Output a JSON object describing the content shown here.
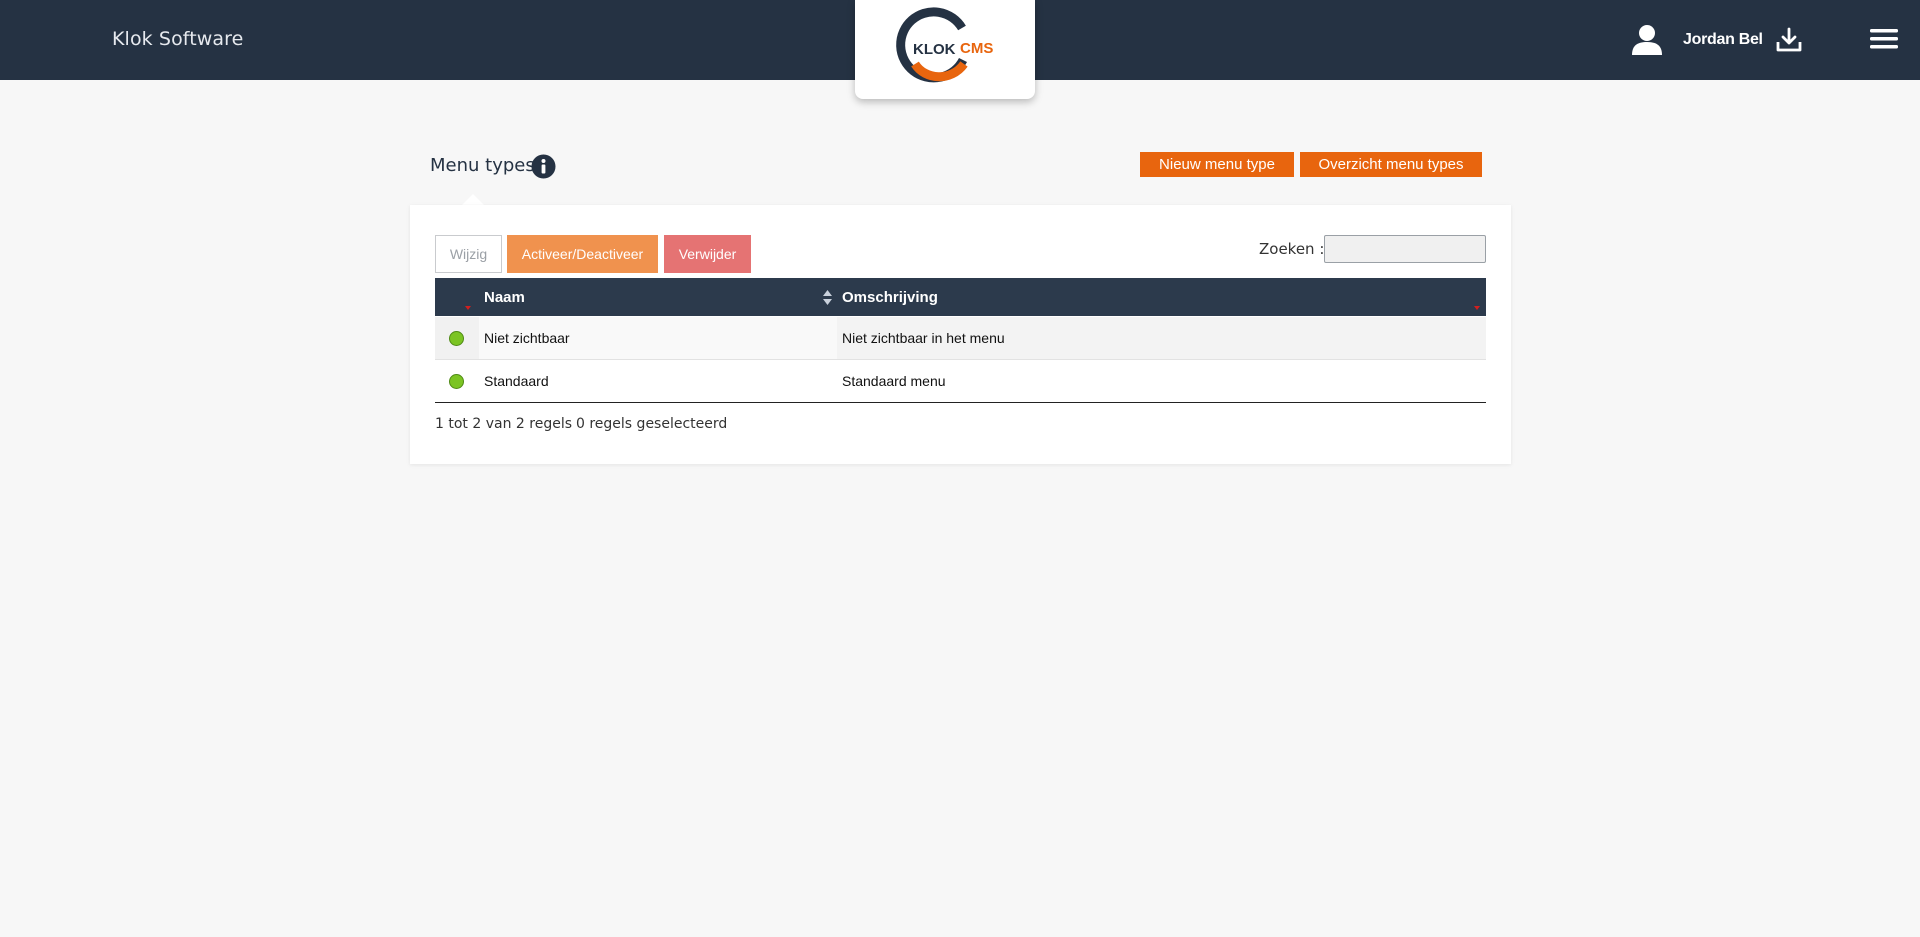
{
  "header": {
    "brand": "Klok Software",
    "logo_text_left": "KLOK",
    "logo_text_right": "CMS",
    "user_name": "Jordan Bel",
    "user_icon": "user-icon",
    "download_icon": "download-icon",
    "menu_icon": "hamburger-menu-icon"
  },
  "page": {
    "title": "Menu types",
    "info_icon": "info-icon",
    "actions": {
      "new_label": "Nieuw menu type",
      "overview_label": "Overzicht menu types"
    }
  },
  "toolbar": {
    "edit_label": "Wijzig",
    "toggle_label": "Activeer/Deactiveer",
    "delete_label": "Verwijder",
    "search_label": "Zoeken :",
    "search_value": ""
  },
  "table": {
    "columns": [
      "Naam",
      "Omschrijving"
    ],
    "rows": [
      {
        "name": "Niet zichtbaar",
        "description": "Niet zichtbaar in het menu",
        "status": "active"
      },
      {
        "name": "Standaard",
        "description": "Standaard menu",
        "status": "active"
      }
    ],
    "info": "1 tot 2 van 2 regels",
    "selected_info": "0 regels geselecteerd"
  },
  "colors": {
    "header_bg": "#253243",
    "accent_orange": "#e8650e",
    "status_active": "#7bc423",
    "delete_red": "#e57373"
  }
}
